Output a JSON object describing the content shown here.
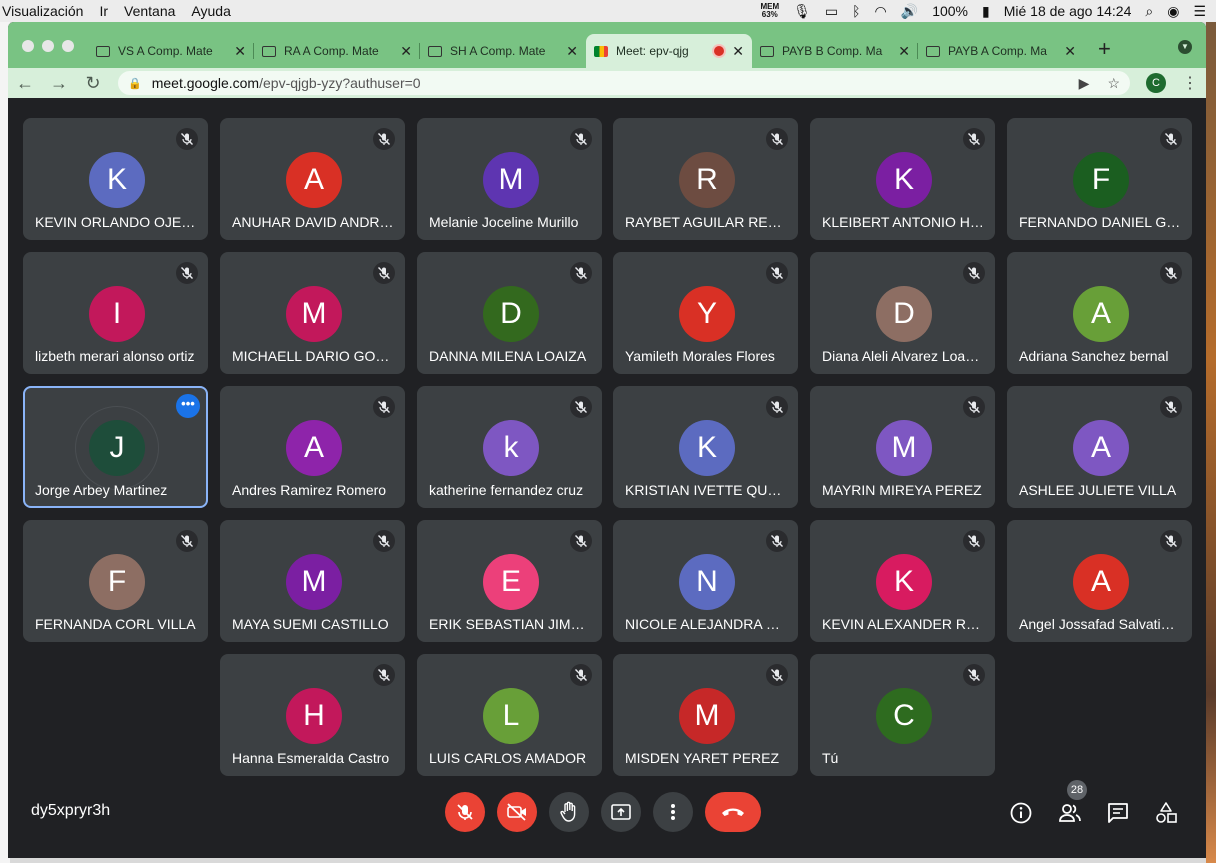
{
  "menubar": {
    "menus": [
      "Visualización",
      "Ir",
      "Ventana",
      "Ayuda"
    ],
    "mem_label": "MEM",
    "mem_value": "63%",
    "battery": "100%",
    "datetime": "Mié 18 de ago  14:24"
  },
  "browser": {
    "tabs": [
      {
        "label": "VS A Comp. Mate",
        "active": false
      },
      {
        "label": "RA A Comp. Mate",
        "active": false
      },
      {
        "label": "SH A Comp. Mate",
        "active": false
      },
      {
        "label": "Meet: epv-qjg",
        "active": true
      },
      {
        "label": "PAYB B Comp. Ma",
        "active": false
      },
      {
        "label": "PAYB A Comp. Ma",
        "active": false
      }
    ],
    "url_host": "meet.google.com",
    "url_path": "/epv-qjgb-yzy?authuser=0",
    "profile_initial": "C"
  },
  "meet": {
    "participants": [
      {
        "initial": "K",
        "name": "KEVIN ORLANDO OJEDA",
        "color": "#5c6bc0"
      },
      {
        "initial": "A",
        "name": "ANUHAR DAVID ANDRADE",
        "color": "#d93025"
      },
      {
        "initial": "M",
        "name": "Melanie Joceline Murillo",
        "color": "#5e35b1"
      },
      {
        "initial": "R",
        "name": "RAYBET AGUILAR RENDON",
        "color": "#6d4c41"
      },
      {
        "initial": "K",
        "name": "KLEIBERT ANTONIO HERRERA",
        "color": "#7b1fa2"
      },
      {
        "initial": "F",
        "name": "FERNANDO DANIEL GARCIA",
        "color": "#1b5e20"
      },
      {
        "initial": "I",
        "name": "lizbeth merari alonso ortiz",
        "color": "#c2185b"
      },
      {
        "initial": "M",
        "name": "MICHAELL DARIO GONZALEZ",
        "color": "#c2185b"
      },
      {
        "initial": "D",
        "name": "DANNA MILENA LOAIZA",
        "color": "#33691e"
      },
      {
        "initial": "Y",
        "name": "Yamileth Morales Flores",
        "color": "#d93025"
      },
      {
        "initial": "D",
        "name": "Diana Aleli Alvarez Loayza",
        "color": "#8d6e63"
      },
      {
        "initial": "A",
        "name": "Adriana Sanchez bernal",
        "color": "#689f38"
      },
      {
        "initial": "J",
        "name": "Jorge Arbey Martinez",
        "color": "#1e4d3a",
        "highlight": true
      },
      {
        "initial": "A",
        "name": "Andres Ramirez Romero",
        "color": "#8e24aa"
      },
      {
        "initial": "k",
        "name": "katherine fernandez cruz",
        "color": "#7e57c2"
      },
      {
        "initial": "K",
        "name": "KRISTIAN IVETTE QUEZADA",
        "color": "#5c6bc0"
      },
      {
        "initial": "M",
        "name": "MAYRIN MIREYA PEREZ",
        "color": "#7e57c2"
      },
      {
        "initial": "A",
        "name": "ASHLEE JULIETE VILLA",
        "color": "#7e57c2"
      },
      {
        "initial": "F",
        "name": "FERNANDA CORL VILLA",
        "color": "#8d6e63"
      },
      {
        "initial": "M",
        "name": "MAYA SUEMI CASTILLO",
        "color": "#7b1fa2"
      },
      {
        "initial": "E",
        "name": "ERIK SEBASTIAN JIMENEZ",
        "color": "#ec407a"
      },
      {
        "initial": "N",
        "name": "NICOLE ALEJANDRA BRAVO",
        "color": "#5c6bc0"
      },
      {
        "initial": "K",
        "name": "KEVIN ALEXANDER RAMOS",
        "color": "#d81b60"
      },
      {
        "initial": "A",
        "name": "Angel Jossafad Salvatierra",
        "color": "#d93025"
      },
      {
        "initial": "H",
        "name": "Hanna Esmeralda Castro",
        "color": "#c2185b"
      },
      {
        "initial": "L",
        "name": "LUIS CARLOS AMADOR",
        "color": "#689f38"
      },
      {
        "initial": "M",
        "name": "MISDEN YARET PEREZ",
        "color": "#c62828"
      },
      {
        "initial": "C",
        "name": "Tú",
        "color": "#2e6b1f"
      }
    ],
    "meeting_code": "dy5xpryr3h",
    "participant_count": "28"
  }
}
